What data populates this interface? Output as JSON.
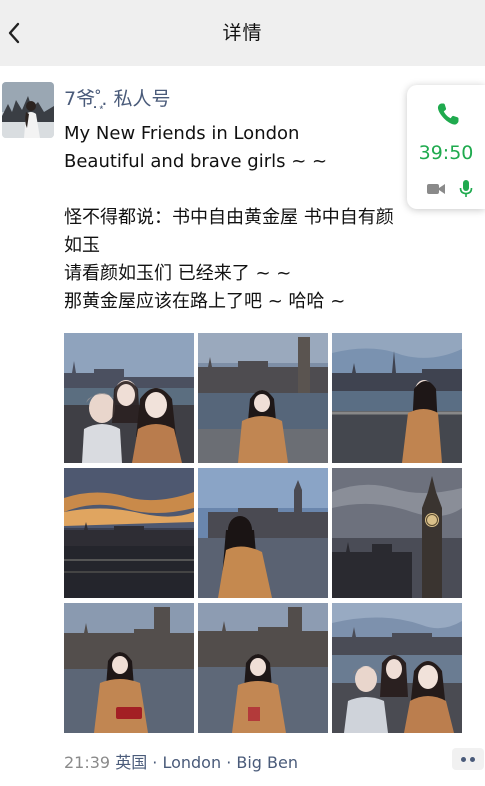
{
  "nav": {
    "title": "详情",
    "back_icon": "chevron-left-icon"
  },
  "post": {
    "username": "7爷˚̣̣̣͙. 私人号",
    "lines": [
      "My New Friends in London",
      "Beautiful and brave girls ~ ~",
      "",
      "怪不得都说：书中自由黄金屋 书中自有颜",
      "如玉",
      "请看颜如玉们 已经来了 ~ ~",
      "那黄金屋应该在路上了吧 ~ 哈哈 ~"
    ],
    "time": "21:39",
    "location": "英国 · London · Big Ben",
    "photos": [
      "photo-1",
      "photo-2",
      "photo-3",
      "photo-4",
      "photo-5",
      "photo-6",
      "photo-7",
      "photo-8",
      "photo-9"
    ]
  },
  "call": {
    "duration": "39:50",
    "accent": "#1faa4e",
    "icons": [
      "phone-icon",
      "video-camera-icon",
      "microphone-icon"
    ]
  },
  "colors": {
    "name": "#4a5b7a",
    "meta": "#8a8a8a",
    "navbar": "#efefef"
  }
}
